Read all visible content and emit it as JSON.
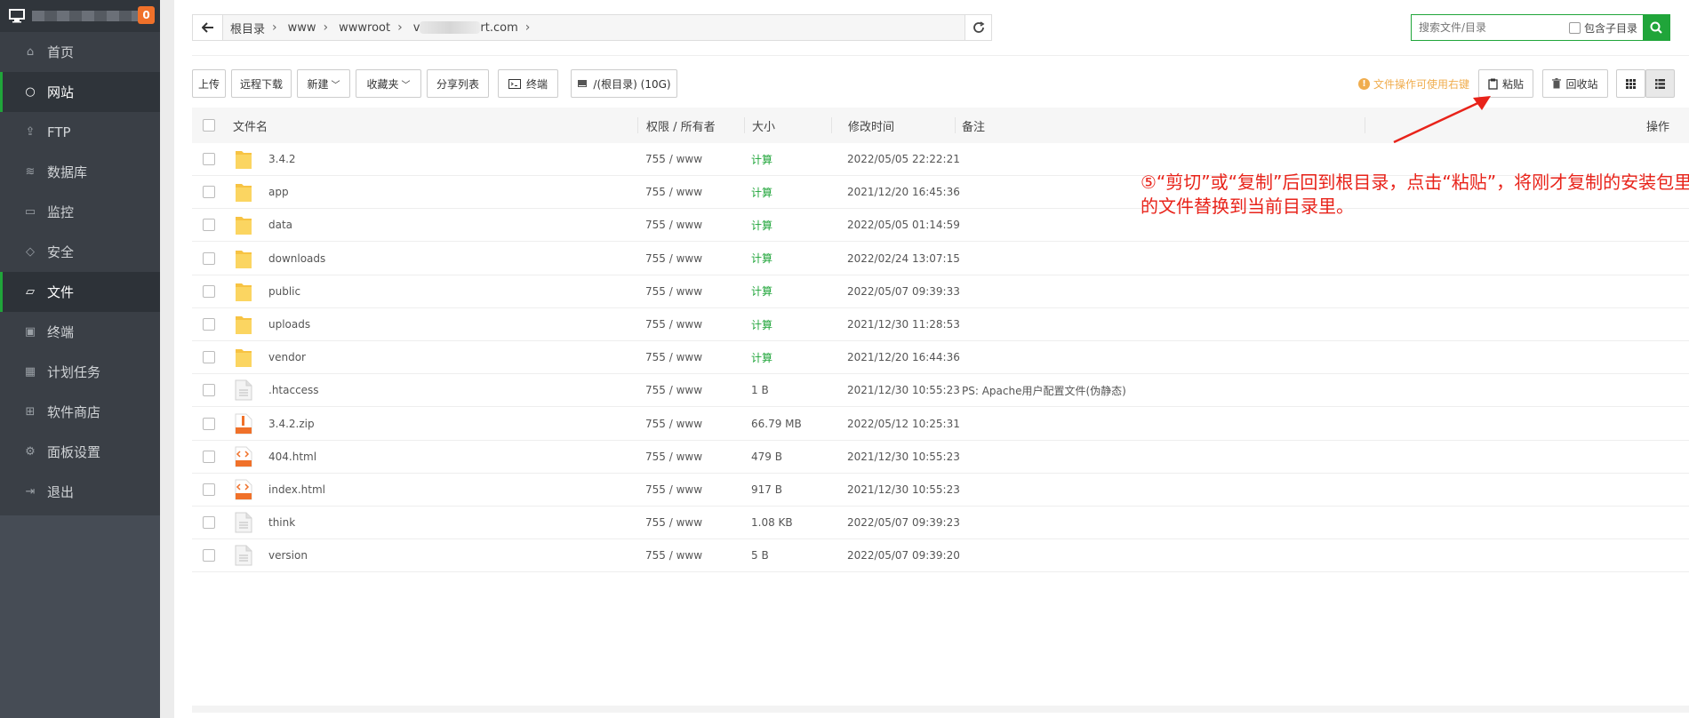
{
  "sidebar": {
    "badge": "0",
    "items": [
      {
        "label": "首页",
        "icon": "home-icon",
        "glyph": "⌂"
      },
      {
        "label": "网站",
        "icon": "globe-icon",
        "glyph": "○",
        "active": true
      },
      {
        "label": "FTP",
        "icon": "ftp-icon",
        "glyph": "⇪"
      },
      {
        "label": "数据库",
        "icon": "database-icon",
        "glyph": "≋"
      },
      {
        "label": "监控",
        "icon": "monitor-icon",
        "glyph": "▭"
      },
      {
        "label": "安全",
        "icon": "shield-icon",
        "glyph": "◇"
      },
      {
        "label": "文件",
        "icon": "folder-icon",
        "glyph": "▱",
        "active": true
      },
      {
        "label": "终端",
        "icon": "terminal-icon",
        "glyph": "▣"
      },
      {
        "label": "计划任务",
        "icon": "calendar-icon",
        "glyph": "▦"
      },
      {
        "label": "软件商店",
        "icon": "grid-icon",
        "glyph": "⊞"
      },
      {
        "label": "面板设置",
        "icon": "gear-icon",
        "glyph": "⚙"
      },
      {
        "label": "退出",
        "icon": "logout-icon",
        "glyph": "⇥"
      }
    ]
  },
  "breadcrumb": {
    "root": "根目录",
    "seg1": "www",
    "seg2": "wwwroot",
    "seg3_prefix": "v",
    "seg3_suffix": "rt.com"
  },
  "search": {
    "placeholder": "搜索文件/目录",
    "include_sub": "包含子目录"
  },
  "toolbar": {
    "upload": "上传",
    "remote_download": "远程下载",
    "new": "新建",
    "favorites": "收藏夹",
    "share_list": "分享列表",
    "terminal": "终端",
    "disk": "/(根目录) (10G)",
    "tip": "文件操作可使用右键",
    "paste": "粘贴",
    "recycle": "回收站"
  },
  "table": {
    "headers": {
      "name": "文件名",
      "perm": "权限 / 所有者",
      "size": "大小",
      "mtime": "修改时间",
      "note": "备注",
      "ops": "操作"
    },
    "rows": [
      {
        "name": "3.4.2",
        "type": "folder",
        "perm": "755 / www",
        "size": "计算",
        "time": "2022/05/05 22:22:21",
        "note": ""
      },
      {
        "name": "app",
        "type": "folder",
        "perm": "755 / www",
        "size": "计算",
        "time": "2021/12/20 16:45:36",
        "note": ""
      },
      {
        "name": "data",
        "type": "folder",
        "perm": "755 / www",
        "size": "计算",
        "time": "2022/05/05 01:14:59",
        "note": ""
      },
      {
        "name": "downloads",
        "type": "folder",
        "perm": "755 / www",
        "size": "计算",
        "time": "2022/02/24 13:07:15",
        "note": ""
      },
      {
        "name": "public",
        "type": "folder",
        "perm": "755 / www",
        "size": "计算",
        "time": "2022/05/07 09:39:33",
        "note": ""
      },
      {
        "name": "uploads",
        "type": "folder",
        "perm": "755 / www",
        "size": "计算",
        "time": "2021/12/30 11:28:53",
        "note": ""
      },
      {
        "name": "vendor",
        "type": "folder",
        "perm": "755 / www",
        "size": "计算",
        "time": "2021/12/20 16:44:36",
        "note": ""
      },
      {
        "name": ".htaccess",
        "type": "file",
        "perm": "755 / www",
        "size": "1 B",
        "time": "2021/12/30 10:55:23",
        "note": "PS: Apache用户配置文件(伪静态)"
      },
      {
        "name": "3.4.2.zip",
        "type": "zip",
        "perm": "755 / www",
        "size": "66.79 MB",
        "time": "2022/05/12 10:25:31",
        "note": ""
      },
      {
        "name": "404.html",
        "type": "html",
        "perm": "755 / www",
        "size": "479 B",
        "time": "2021/12/30 10:55:23",
        "note": ""
      },
      {
        "name": "index.html",
        "type": "html",
        "perm": "755 / www",
        "size": "917 B",
        "time": "2021/12/30 10:55:23",
        "note": ""
      },
      {
        "name": "think",
        "type": "file",
        "perm": "755 / www",
        "size": "1.08 KB",
        "time": "2022/05/07 09:39:23",
        "note": ""
      },
      {
        "name": "version",
        "type": "file",
        "perm": "755 / www",
        "size": "5 B",
        "time": "2022/05/07 09:39:20",
        "note": ""
      }
    ]
  },
  "annotation": {
    "line1": "⑤“剪切”或“复制”后回到根目录，点击“粘贴”，将刚才复制的安装包里",
    "line2": "的文件替换到当前目录里。",
    "color": "#e8231a"
  },
  "colors": {
    "accent": "#20a53a",
    "sidebar_bg": "#3a3f46",
    "badge": "#f0712a",
    "tip": "#f0ad4e"
  }
}
